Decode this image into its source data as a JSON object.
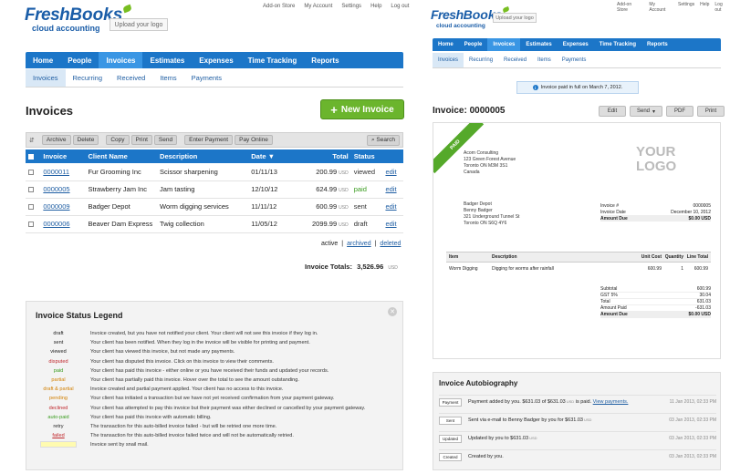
{
  "left": {
    "toplinks": [
      "Add-on Store",
      "My Account",
      "Settings",
      "Help",
      "Log out"
    ],
    "logo": {
      "fresh": "Fresh",
      "books": "Books",
      "sub": "cloud accounting"
    },
    "upload_logo": "Upload your logo",
    "nav": [
      "Home",
      "People",
      "Invoices",
      "Estimates",
      "Expenses",
      "Time Tracking",
      "Reports"
    ],
    "nav_active": 2,
    "subnav": [
      "Invoices",
      "Recurring",
      "Received",
      "Items",
      "Payments"
    ],
    "page_title": "Invoices",
    "new_invoice": "New Invoice",
    "toolbar": {
      "archive": "Archive",
      "delete": "Delete",
      "copy": "Copy",
      "print": "Print",
      "send": "Send",
      "enter_payment": "Enter Payment",
      "pay_online": "Pay Online",
      "search": "Search"
    },
    "table": {
      "headers": [
        "Invoice",
        "Client Name",
        "Description",
        "Date ▼",
        "Total",
        "Status"
      ],
      "rows": [
        {
          "invoice": "0000011",
          "client": "Fur Grooming Inc",
          "description": "Scissor sharpening",
          "date": "01/11/13",
          "total": "200.99",
          "currency": "USD",
          "status": "viewed",
          "action": "edit"
        },
        {
          "invoice": "0000005",
          "client": "Strawberry Jam Inc",
          "description": "Jam tasting",
          "date": "12/10/12",
          "total": "624.99",
          "currency": "USD",
          "status": "paid",
          "action": "edit"
        },
        {
          "invoice": "0000009",
          "client": "Badger Depot",
          "description": "Worm digging services",
          "date": "11/11/12",
          "total": "600.99",
          "currency": "USD",
          "status": "sent",
          "action": "edit"
        },
        {
          "invoice": "0000006",
          "client": "Beaver Dam Express",
          "description": "Twig collection",
          "date": "11/05/12",
          "total": "2099.99",
          "currency": "USD",
          "status": "draft",
          "action": "edit"
        }
      ]
    },
    "filters": {
      "active": "active",
      "archived": "archived",
      "deleted": "deleted"
    },
    "totals": {
      "label": "Invoice Totals:",
      "value": "3,526.96",
      "currency": "USD"
    },
    "legend": {
      "title": "Invoice Status Legend",
      "rows": [
        {
          "key": "draft",
          "desc": "Invoice created, but you have not notified your client. Your client will not see this invoice if they log in."
        },
        {
          "key": "sent",
          "desc": "Your client has been notified. When they log in the invoice will be visible for printing and payment."
        },
        {
          "key": "viewed",
          "desc": "Your client has viewed this invoice, but not made any payments."
        },
        {
          "key": "disputed",
          "desc": "Your client has disputed this invoice. Click on this invoice to view their comments."
        },
        {
          "key": "paid",
          "desc": "Your client has paid this invoice - either online or you have received their funds and updated your records."
        },
        {
          "key": "partial",
          "desc": "Your client has partially paid this invoice. Hover over the total to see the amount outstanding."
        },
        {
          "key": "draft & partial",
          "desc": "Invoice created and partial payment applied. Your client has no access to this invoice."
        },
        {
          "key": "pending",
          "desc": "Your client has initiated a transaction but we have not yet received confirmation from your payment gateway."
        },
        {
          "key": "declined",
          "desc": "Your client has attempted to pay this invoice but their payment was either declined or cancelled by your payment gateway."
        },
        {
          "key": "auto-paid",
          "desc": "Your client has paid this invoice with automatic billing."
        },
        {
          "key": "retry",
          "desc": "The transaction for this auto-billed invoice failed - but will be retried one more time."
        },
        {
          "key": "failed",
          "desc": "The transaction for this auto-billed invoice failed twice and will not be automatically retried."
        },
        {
          "key": "",
          "desc": "Invoice sent by snail mail."
        }
      ]
    }
  },
  "right": {
    "toplinks": [
      "Add-on Store",
      "My Account",
      "Settings",
      "Help",
      "Log out"
    ],
    "logo": {
      "fresh": "Fresh",
      "books": "Books",
      "sub": "cloud accounting"
    },
    "upload_logo": "Upload your logo",
    "nav": [
      "Home",
      "People",
      "Invoices",
      "Estimates",
      "Expenses",
      "Time Tracking",
      "Reports"
    ],
    "nav_active": 2,
    "subnav": [
      "Invoices",
      "Recurring",
      "Received",
      "Items",
      "Payments"
    ],
    "notice": "Invoice paid in full on March 7, 2012.",
    "title": "Invoice: 0000005",
    "actions": {
      "edit": "Edit",
      "send": "Send",
      "pdf": "PDF",
      "print": "Print"
    },
    "invoice": {
      "ribbon": "PAID",
      "from": [
        "Acorn Consulting",
        "123 Green Forest Avenue",
        "Toronto ON  M3M 3S1",
        "Canada"
      ],
      "logo_placeholder": [
        "YOUR",
        "LOGO"
      ],
      "to": [
        "Badger Depot",
        "Benny Badger",
        "321 Underground Tunnel St",
        "Toronto ON  S6Q 4Y6"
      ],
      "meta": [
        {
          "label": "Invoice #",
          "value": "0000005"
        },
        {
          "label": "Invoice Date",
          "value": "December 10, 2012"
        },
        {
          "label": "Amount Due",
          "value": "$0.00 USD",
          "hl": true
        }
      ],
      "item_headers": [
        "Item",
        "Description",
        "Unit Cost",
        "Quantity",
        "Line Total"
      ],
      "items": [
        {
          "item": "Worm Digging",
          "description": "Digging for worms after rainfall",
          "unit_cost": "600.99",
          "qty": "1",
          "total": "600.99"
        }
      ],
      "summary": [
        {
          "label": "Subtotal",
          "value": "600.99",
          "hl": false
        },
        {
          "label": "GST 5%",
          "value": "30.04",
          "hl": false
        },
        {
          "label": "Total",
          "value": "631.03",
          "hl": false
        },
        {
          "label": "Amount Paid",
          "value": "-631.03",
          "hl": false
        },
        {
          "label": "Amount Due",
          "value": "$0.00 USD",
          "hl": true
        }
      ]
    },
    "bio": {
      "title": "Invoice Autobiography",
      "rows": [
        {
          "tag": "Payment",
          "text": "Payment added by you. $631.03 of $631.03",
          "usd": "USD",
          "tail": " is paid. ",
          "link": "View payments.",
          "date": "11 Jan 2013, 02:33 PM"
        },
        {
          "tag": "Sent",
          "text": "Sent via e-mail to Benny Badger by you for $631.03",
          "usd": "USD",
          "tail": "",
          "link": "",
          "date": "03 Jan 2013, 02:33 PM"
        },
        {
          "tag": "Updated",
          "text": "Updated by you to $631.03",
          "usd": "USD",
          "tail": "",
          "link": "",
          "date": "03 Jan 2013, 02:33 PM"
        },
        {
          "tag": "Created",
          "text": "Created by you.",
          "usd": "",
          "tail": "",
          "link": "",
          "date": "03 Jan 2013, 02:33 PM"
        }
      ]
    }
  }
}
